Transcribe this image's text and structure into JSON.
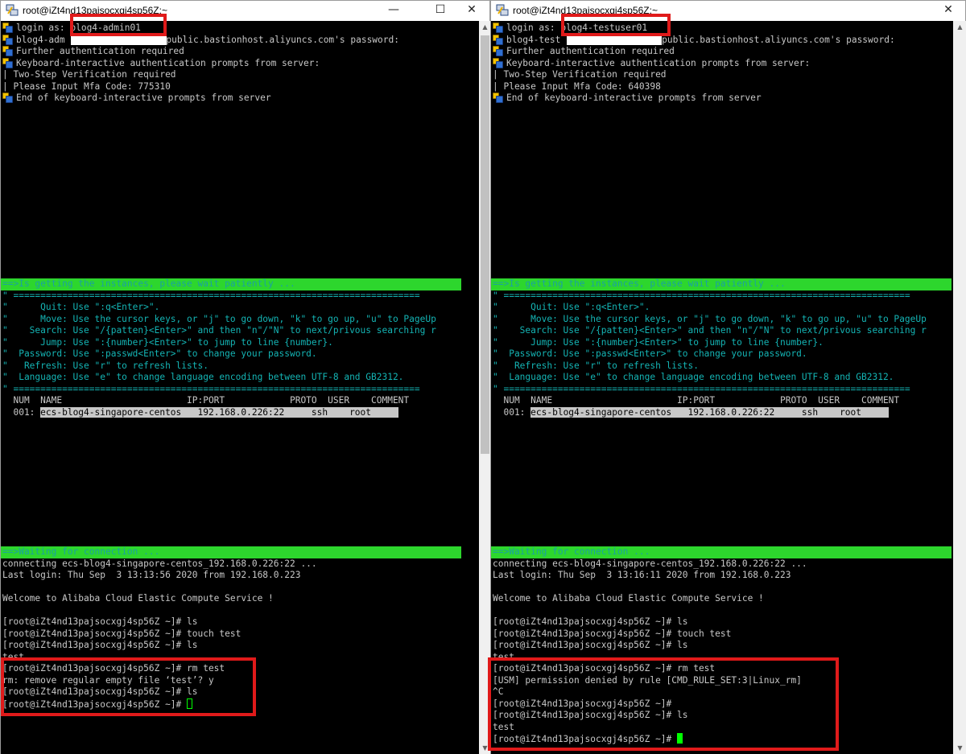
{
  "left": {
    "title": "root@iZt4nd13pajsocxgj4sp56Z:~",
    "controls": {
      "minimize": "—",
      "maximize": "☐",
      "close": "✕"
    },
    "login_prefix": "login as: ",
    "login_user": "blog4-admin01",
    "password_prefix": "blog4-adm",
    "password_suffix": "-public.bastionhost.aliyuncs.com's password:",
    "auth_lines": [
      "Further authentication required",
      "Keyboard-interactive authentication prompts from server:"
    ],
    "plain_lines": [
      "| Two-Step Verification required",
      "| Please Input Mfa Code: 775310"
    ],
    "end_line": "End of keyboard-interactive prompts from server",
    "instances_banner": "==>Is getting the instances, please wait patiently ...",
    "help_lines": [
      "\" ===========================================================================",
      "\"      Quit: Use \":q<Enter>\".",
      "\"      Move: Use the cursor keys, or \"j\" to go down, \"k\" to go up, \"u\" to PageUp",
      "\"    Search: Use \"/{patten}<Enter>\" and then \"n\"/\"N\" to next/privous searching r",
      "\"      Jump: Use \":{number}<Enter>\" to jump to line {number}.",
      "\"  Password: Use \":passwd<Enter>\" to change your password.",
      "\"   Refresh: Use \"r\" to refresh lists.",
      "\"  Language: Use \"e\" to change language encoding between UTF-8 and GB2312.",
      "\" ==========================================================================="
    ],
    "table_header": "  NUM  NAME                       IP:PORT            PROTO  USER    COMMENT",
    "table_row_num": "  001: ",
    "table_row_sel": "ecs-blog4-singapore-centos   192.168.0.226:22     ssh    root     ",
    "waiting_banner": "==>Waiting for connection ...",
    "session_lines": [
      "connecting ecs-blog4-singapore-centos_192.168.0.226:22 ...",
      "Last login: Thu Sep  3 13:13:56 2020 from 192.168.0.223",
      "",
      "Welcome to Alibaba Cloud Elastic Compute Service !",
      "",
      "[root@iZt4nd13pajsocxgj4sp56Z ~]# ls",
      "[root@iZt4nd13pajsocxgj4sp56Z ~]# touch test",
      "[root@iZt4nd13pajsocxgj4sp56Z ~]# ls",
      "test",
      "[root@iZt4nd13pajsocxgj4sp56Z ~]# rm test",
      "rm: remove regular empty file ‘test’? y",
      "[root@iZt4nd13pajsocxgj4sp56Z ~]# ls"
    ],
    "final_prompt": "[root@iZt4nd13pajsocxgj4sp56Z ~]# "
  },
  "right": {
    "title": "root@iZt4nd13pajsocxgj4sp56Z:~",
    "controls": {
      "close": "✕"
    },
    "login_prefix": "login as: ",
    "login_user": "blog4-testuser01",
    "password_prefix": "blog4-test",
    "password_suffix": "-public.bastionhost.aliyuncs.com's password:",
    "auth_lines": [
      "Further authentication required",
      "Keyboard-interactive authentication prompts from server:"
    ],
    "plain_lines": [
      "| Two-Step Verification required",
      "| Please Input Mfa Code: 640398"
    ],
    "end_line": "End of keyboard-interactive prompts from server",
    "instances_banner": "==>Is getting the instances, please wait patiently ...",
    "help_lines": [
      "\" ===========================================================================",
      "\"      Quit: Use \":q<Enter>\".",
      "\"      Move: Use the cursor keys, or \"j\" to go down, \"k\" to go up, \"u\" to PageUp",
      "\"    Search: Use \"/{patten}<Enter>\" and then \"n\"/\"N\" to next/privous searching r",
      "\"      Jump: Use \":{number}<Enter>\" to jump to line {number}.",
      "\"  Password: Use \":passwd<Enter>\" to change your password.",
      "\"   Refresh: Use \"r\" to refresh lists.",
      "\"  Language: Use \"e\" to change language encoding between UTF-8 and GB2312.",
      "\" ==========================================================================="
    ],
    "table_header": "  NUM  NAME                       IP:PORT            PROTO  USER    COMMENT",
    "table_row_num": "  001: ",
    "table_row_sel": "ecs-blog4-singapore-centos   192.168.0.226:22     ssh    root     ",
    "waiting_banner": "==>Waiting for connection ...",
    "session_lines": [
      "connecting ecs-blog4-singapore-centos_192.168.0.226:22 ...",
      "Last login: Thu Sep  3 13:16:11 2020 from 192.168.0.223",
      "",
      "Welcome to Alibaba Cloud Elastic Compute Service !",
      "",
      "[root@iZt4nd13pajsocxgj4sp56Z ~]# ls",
      "[root@iZt4nd13pajsocxgj4sp56Z ~]# touch test",
      "[root@iZt4nd13pajsocxgj4sp56Z ~]# ls",
      "test",
      "[root@iZt4nd13pajsocxgj4sp56Z ~]# rm test",
      "[USM] permission denied by rule [CMD_RULE_SET:3|Linux_rm]",
      "^C",
      "[root@iZt4nd13pajsocxgj4sp56Z ~]#",
      "[root@iZt4nd13pajsocxgj4sp56Z ~]# ls",
      "test"
    ],
    "final_prompt": "[root@iZt4nd13pajsocxgj4sp56Z ~]# "
  }
}
